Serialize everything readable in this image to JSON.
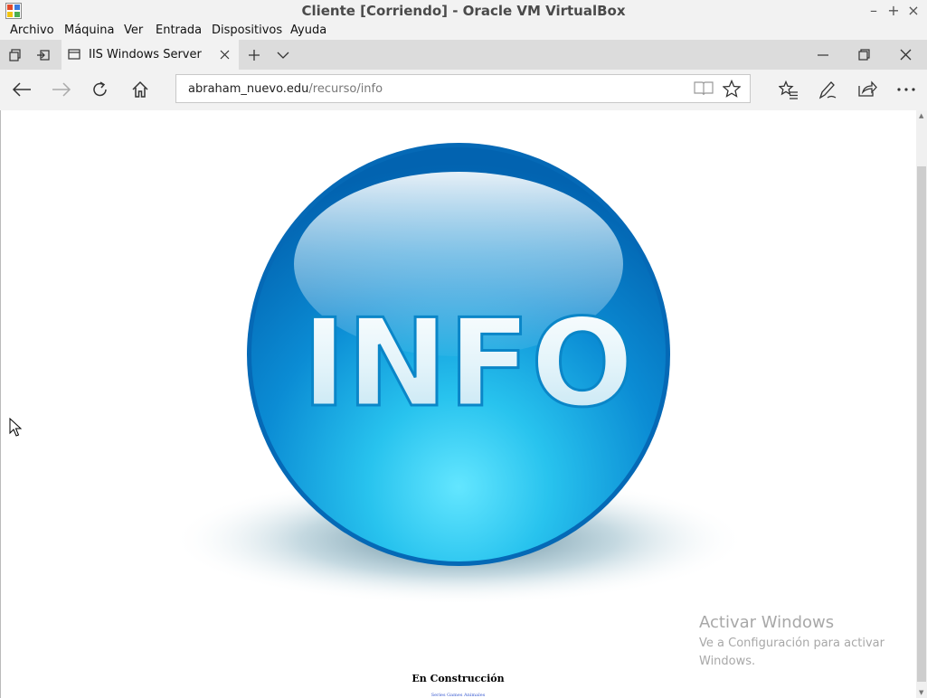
{
  "virtualbox": {
    "title": "Cliente [Corriendo] - Oracle VM VirtualBox",
    "menu": [
      "Archivo",
      "Máquina",
      "Ver",
      "Entrada",
      "Dispositivos",
      "Ayuda"
    ],
    "controls": {
      "minimize": "–",
      "maximize": "+",
      "close": "×"
    }
  },
  "browser": {
    "tab": {
      "title": "IIS Windows Server"
    },
    "address": {
      "host": "abraham_nuevo.edu",
      "path": "/recurso/info"
    },
    "icons": [
      "tab-manager-icon",
      "set-aside-tabs-icon",
      "page-icon",
      "close-icon",
      "new-tab-icon",
      "chevron-down-icon",
      "minimize-icon",
      "restore-icon",
      "close-window-icon",
      "back-icon",
      "forward-icon",
      "refresh-icon",
      "home-icon",
      "reading-view-icon",
      "favorite-star-icon",
      "favorites-hub-icon",
      "pen-icon",
      "share-icon",
      "more-icon"
    ]
  },
  "page": {
    "orb_text": "INFO",
    "heading": "En Construcción",
    "sublinks": "Series Games Animales"
  },
  "watermark": {
    "title": "Activar Windows",
    "text": "Ve a Configuración para activar Windows."
  },
  "colors": {
    "orb_dark": "#0069b8",
    "orb_light": "#25c8ef",
    "chrome_bg": "#f2f2f2",
    "tabbar_bg": "#dcdcdc"
  }
}
